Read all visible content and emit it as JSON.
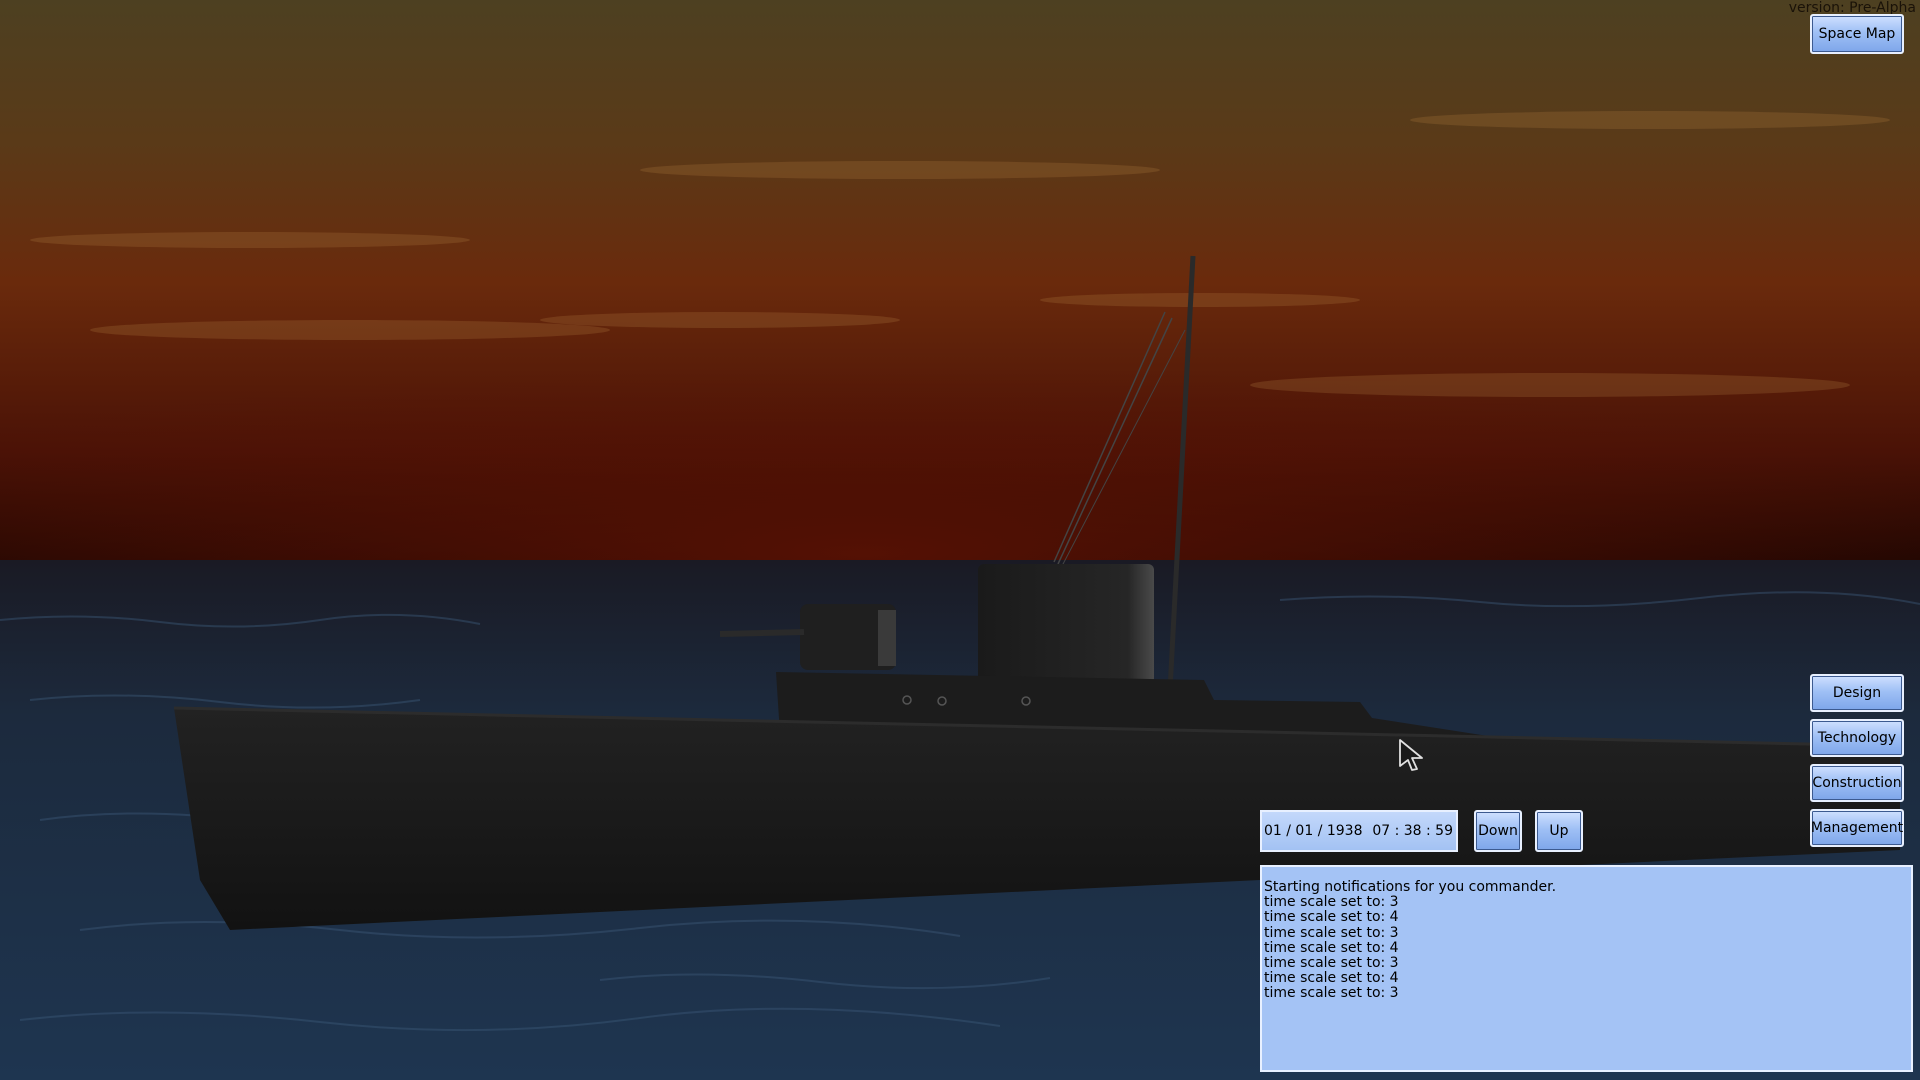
{
  "version": "version: Pre-Alpha",
  "top_right": {
    "space_map_label": "Space Map"
  },
  "side_menu": {
    "design_label": "Design",
    "technology_label": "Technology",
    "construction_label": "Construction",
    "management_label": "Management"
  },
  "time_control": {
    "date": "01 / 01 / 1938",
    "time": "07 : 38 : 59",
    "down_label": "Down",
    "up_label": "Up"
  },
  "notifications": {
    "lines": [
      "Starting notifications for you commander.",
      "time scale set to: 3",
      "time scale set to: 4",
      "time scale set to: 3",
      "time scale set to: 4",
      "time scale set to: 3",
      "time scale set to: 4",
      "time scale set to: 3"
    ]
  },
  "colors": {
    "button_fill": "#9fc0f5",
    "panel_fill": "#a4c3f5",
    "sky_top": "#4a3a20",
    "sky_horizon": "#3a0d04",
    "sea": "#1b2c42",
    "hull": "#151515"
  }
}
